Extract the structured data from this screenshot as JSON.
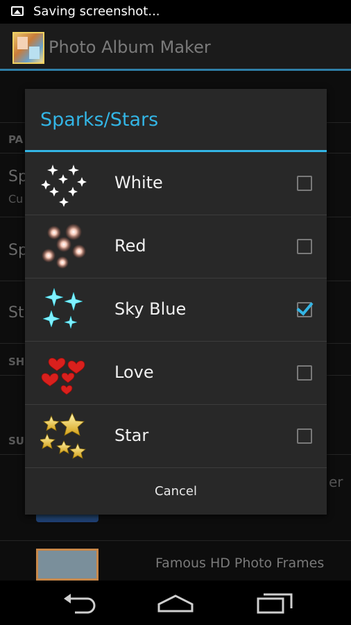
{
  "status_bar": {
    "notification_text": "Saving screenshot...",
    "notification_icon": "image-icon"
  },
  "action_bar": {
    "title": "Photo Album Maker",
    "icon": "app-icon"
  },
  "background": {
    "header1": "PA",
    "item1": "Sp",
    "item1_sub": "Cu",
    "item2": "Sp",
    "item3": "St",
    "header2": "SH",
    "header3": "SU",
    "right_text": "er",
    "frames_label": "Famous HD Photo Frames"
  },
  "dialog": {
    "title": "Sparks/Stars",
    "options": [
      {
        "label": "White",
        "checked": false,
        "icon": "white-sparks"
      },
      {
        "label": "Red",
        "checked": false,
        "icon": "red-sparks"
      },
      {
        "label": "Sky Blue",
        "checked": true,
        "icon": "sky-blue-sparks"
      },
      {
        "label": "Love",
        "checked": false,
        "icon": "hearts"
      },
      {
        "label": "Star",
        "checked": false,
        "icon": "gold-stars"
      }
    ],
    "cancel_label": "Cancel"
  },
  "colors": {
    "accent": "#33b5e5",
    "dialog_bg": "#282828",
    "action_bar_underline": "#2f7fa8"
  }
}
